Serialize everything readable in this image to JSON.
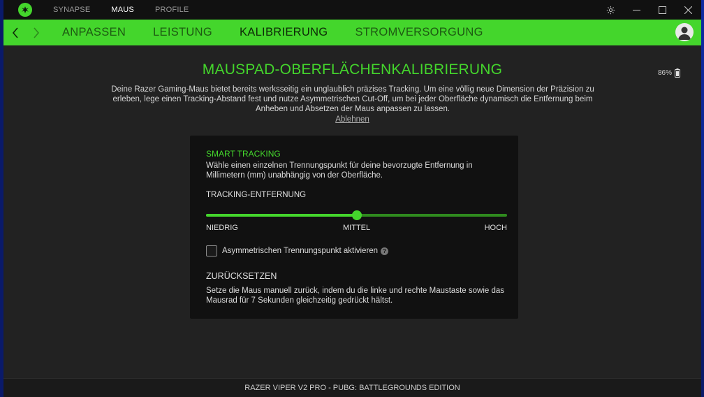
{
  "topbar": {
    "tabs": [
      {
        "label": "SYNAPSE",
        "active": false
      },
      {
        "label": "MAUS",
        "active": true
      },
      {
        "label": "PROFILE",
        "active": false
      }
    ],
    "icons": [
      "razer-logo-icon",
      "gear-icon",
      "minimize-icon",
      "maximize-icon",
      "close-icon"
    ]
  },
  "nav": {
    "tabs": [
      {
        "label": "ANPASSEN",
        "active": false
      },
      {
        "label": "LEISTUNG",
        "active": false
      },
      {
        "label": "KALIBRIERUNG",
        "active": true
      },
      {
        "label": "STROMVERSORGUNG",
        "active": false
      }
    ]
  },
  "main": {
    "title": "MAUSPAD-OBERFLÄCHENKALIBRIERUNG",
    "battery": "86%",
    "intro": "Deine Razer Gaming-Maus bietet bereits werksseitig ein unglaublich präzises Tracking. Um eine völlig neue Dimension der Präzision zu erleben, lege einen Tracking-Abstand fest und nutze Asymmetrischen Cut-Off, um bei jeder Oberfläche dynamisch die Entfernung beim Anheben und Absetzen der Maus anpassen zu lassen.",
    "decline": "Ablehnen"
  },
  "card": {
    "heading": "SMART TRACKING",
    "description": "Wähle einen einzelnen Trennungspunkt für deine bevorzugte Entfernung in Millimetern (mm) unabhängig von der Oberfläche.",
    "tracking_label": "TRACKING-ENTFERNUNG",
    "slider": {
      "value": 0.5,
      "low": "NIEDRIG",
      "mid": "MITTEL",
      "high": "HOCH"
    },
    "checkbox_label": "Asymmetrischen Trennungspunkt aktivieren",
    "checkbox_checked": false,
    "reset_heading": "ZURÜCKSETZEN",
    "reset_description": "Setze die Maus manuell zurück, indem du die linke und rechte Maustaste sowie das Mausrad für 7 Sekunden gleichzeitig gedrückt hältst."
  },
  "footer": {
    "device": "RAZER VIPER V2 PRO - PUBG: BATTLEGROUNDS EDITION"
  },
  "colors": {
    "accent": "#44d62c",
    "background": "#222222",
    "card": "#111111"
  }
}
